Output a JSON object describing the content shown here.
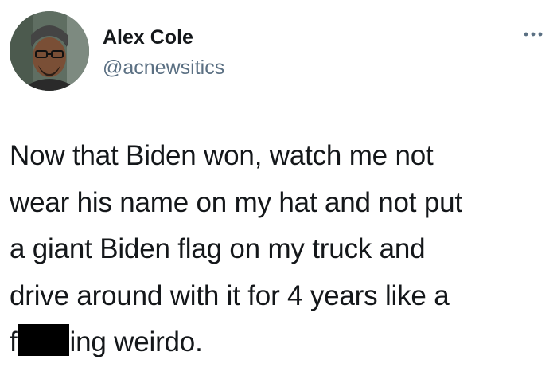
{
  "tweet": {
    "author_name": "Alex Cole",
    "author_handle": "@acnewsitics",
    "more_icon": "more-horizontal-icon",
    "text_lines": [
      "Now that Biden won, watch me not",
      "wear his name on my hat and not put",
      "a giant Biden flag on my truck and",
      "drive around with it for 4 years like a"
    ],
    "last_line_prefix": "f",
    "last_line_suffix": "ing weirdo."
  }
}
